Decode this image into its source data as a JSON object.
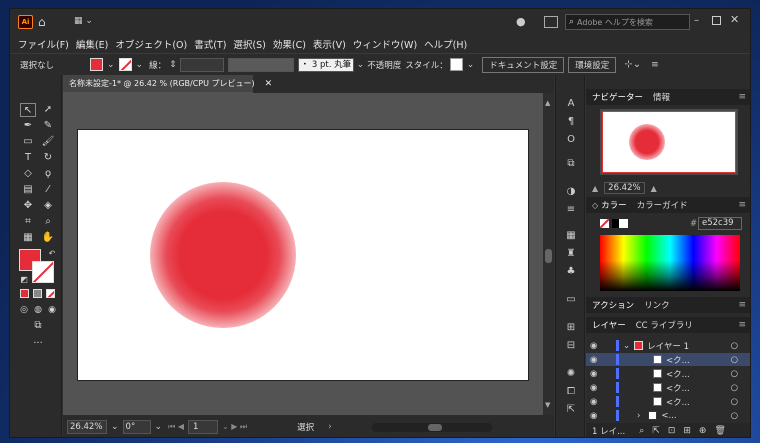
{
  "window": {
    "logo": "Ai",
    "search_placeholder": "Adobe ヘルプを検索"
  },
  "menu": [
    "ファイル(F)",
    "編集(E)",
    "オブジェクト(O)",
    "書式(T)",
    "選択(S)",
    "効果(C)",
    "表示(V)",
    "ウィンドウ(W)",
    "ヘルプ(H)"
  ],
  "control": {
    "selection": "選択なし",
    "stroke_label": "線：",
    "stroke_style": "・ 3 pt. 丸筆",
    "opacity_label": "不透明度",
    "style_label": "スタイル：",
    "doc_settings": "ドキュメント設定",
    "prefs": "環境設定"
  },
  "document": {
    "tab_title": "名称未設定-1* @ 26.42 % (RGB/CPU プレビュー)"
  },
  "status": {
    "zoom": "26.42%",
    "rotate": "0°",
    "page": "1",
    "mode": "選択"
  },
  "navigator": {
    "tabs": [
      "ナビゲーター",
      "情報"
    ],
    "zoom": "26.42%"
  },
  "color": {
    "tabs": [
      "カラー",
      "カラーガイド"
    ],
    "hex": "e52c39"
  },
  "actions": {
    "tabs": [
      "アクション",
      "リンク"
    ]
  },
  "layers": {
    "tabs": [
      "レイヤー",
      "CC ライブラリ"
    ],
    "layer_name": "レイヤー 1",
    "sublayers": [
      "<ク...",
      "<ク...",
      "<ク...",
      "<ク...",
      "<..."
    ],
    "footer": "1 レイ..."
  },
  "colors": {
    "accent": "#e52c39"
  }
}
